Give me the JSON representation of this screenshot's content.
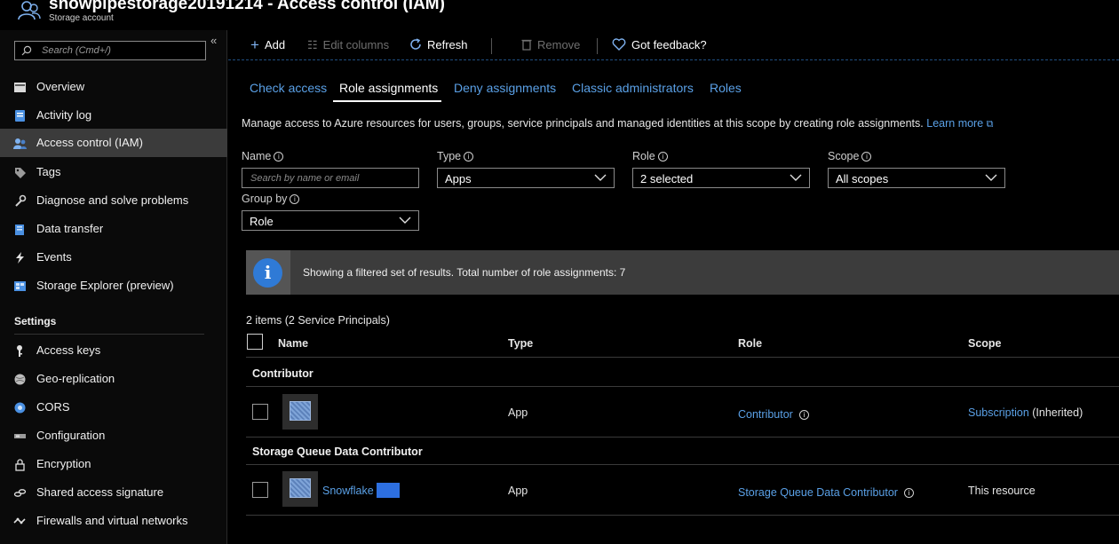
{
  "header": {
    "title": "snowpipestorage20191214 - Access control (IAM)",
    "subtitle": "Storage account"
  },
  "sidebar": {
    "search_placeholder": "Search (Cmd+/)",
    "collapse_glyph": "«",
    "items": [
      {
        "label": "Overview",
        "icon": "overview-icon"
      },
      {
        "label": "Activity log",
        "icon": "activity-log-icon"
      },
      {
        "label": "Access control (IAM)",
        "icon": "people-icon",
        "active": true
      },
      {
        "label": "Tags",
        "icon": "tag-icon"
      },
      {
        "label": "Diagnose and solve problems",
        "icon": "wrench-icon"
      },
      {
        "label": "Data transfer",
        "icon": "data-transfer-icon"
      },
      {
        "label": "Events",
        "icon": "lightning-icon"
      },
      {
        "label": "Storage Explorer (preview)",
        "icon": "storage-explorer-icon"
      }
    ],
    "settings_label": "Settings",
    "settings_items": [
      {
        "label": "Access keys",
        "icon": "key-icon"
      },
      {
        "label": "Geo-replication",
        "icon": "globe-icon"
      },
      {
        "label": "CORS",
        "icon": "cors-icon"
      },
      {
        "label": "Configuration",
        "icon": "configuration-icon"
      },
      {
        "label": "Encryption",
        "icon": "lock-icon"
      },
      {
        "label": "Shared access signature",
        "icon": "link-icon"
      },
      {
        "label": "Firewalls and virtual networks",
        "icon": "network-icon"
      }
    ]
  },
  "toolbar": {
    "add": "Add",
    "edit_columns": "Edit columns",
    "refresh": "Refresh",
    "remove": "Remove",
    "feedback": "Got feedback?"
  },
  "tabs": [
    "Check access",
    "Role assignments",
    "Deny assignments",
    "Classic administrators",
    "Roles"
  ],
  "active_tab": "Role assignments",
  "description": {
    "text": "Manage access to Azure resources for users, groups, service principals and managed identities at this scope by creating role assignments.",
    "link": "Learn more"
  },
  "filters": {
    "name_label": "Name",
    "name_placeholder": "Search by name or email",
    "type_label": "Type",
    "type_value": "Apps",
    "role_label": "Role",
    "role_value": "2 selected",
    "scope_label": "Scope",
    "scope_value": "All scopes",
    "group_by_label": "Group by",
    "group_by_value": "Role"
  },
  "banner": {
    "text": "Showing a filtered set of results. Total number of role assignments: 7"
  },
  "table": {
    "count": "2 items (2 Service Principals)",
    "columns": [
      "Name",
      "Type",
      "Role",
      "Scope"
    ],
    "groups": [
      {
        "name": "Contributor",
        "rows": [
          {
            "name": "",
            "type": "App",
            "role": "Contributor",
            "scope_link": "Subscription",
            "scope_suffix": " (Inherited)"
          }
        ]
      },
      {
        "name": "Storage Queue Data Contributor",
        "rows": [
          {
            "name": "Snowflake",
            "type": "App",
            "role": "Storage Queue Data Contributor",
            "scope_text": "This resource"
          }
        ]
      }
    ]
  },
  "colors": {
    "accent_link": "#5aa0e6",
    "active_nav": "#3b3b3b",
    "banner_bg": "#3c3c3c",
    "info_blue": "#2f7ad6"
  }
}
